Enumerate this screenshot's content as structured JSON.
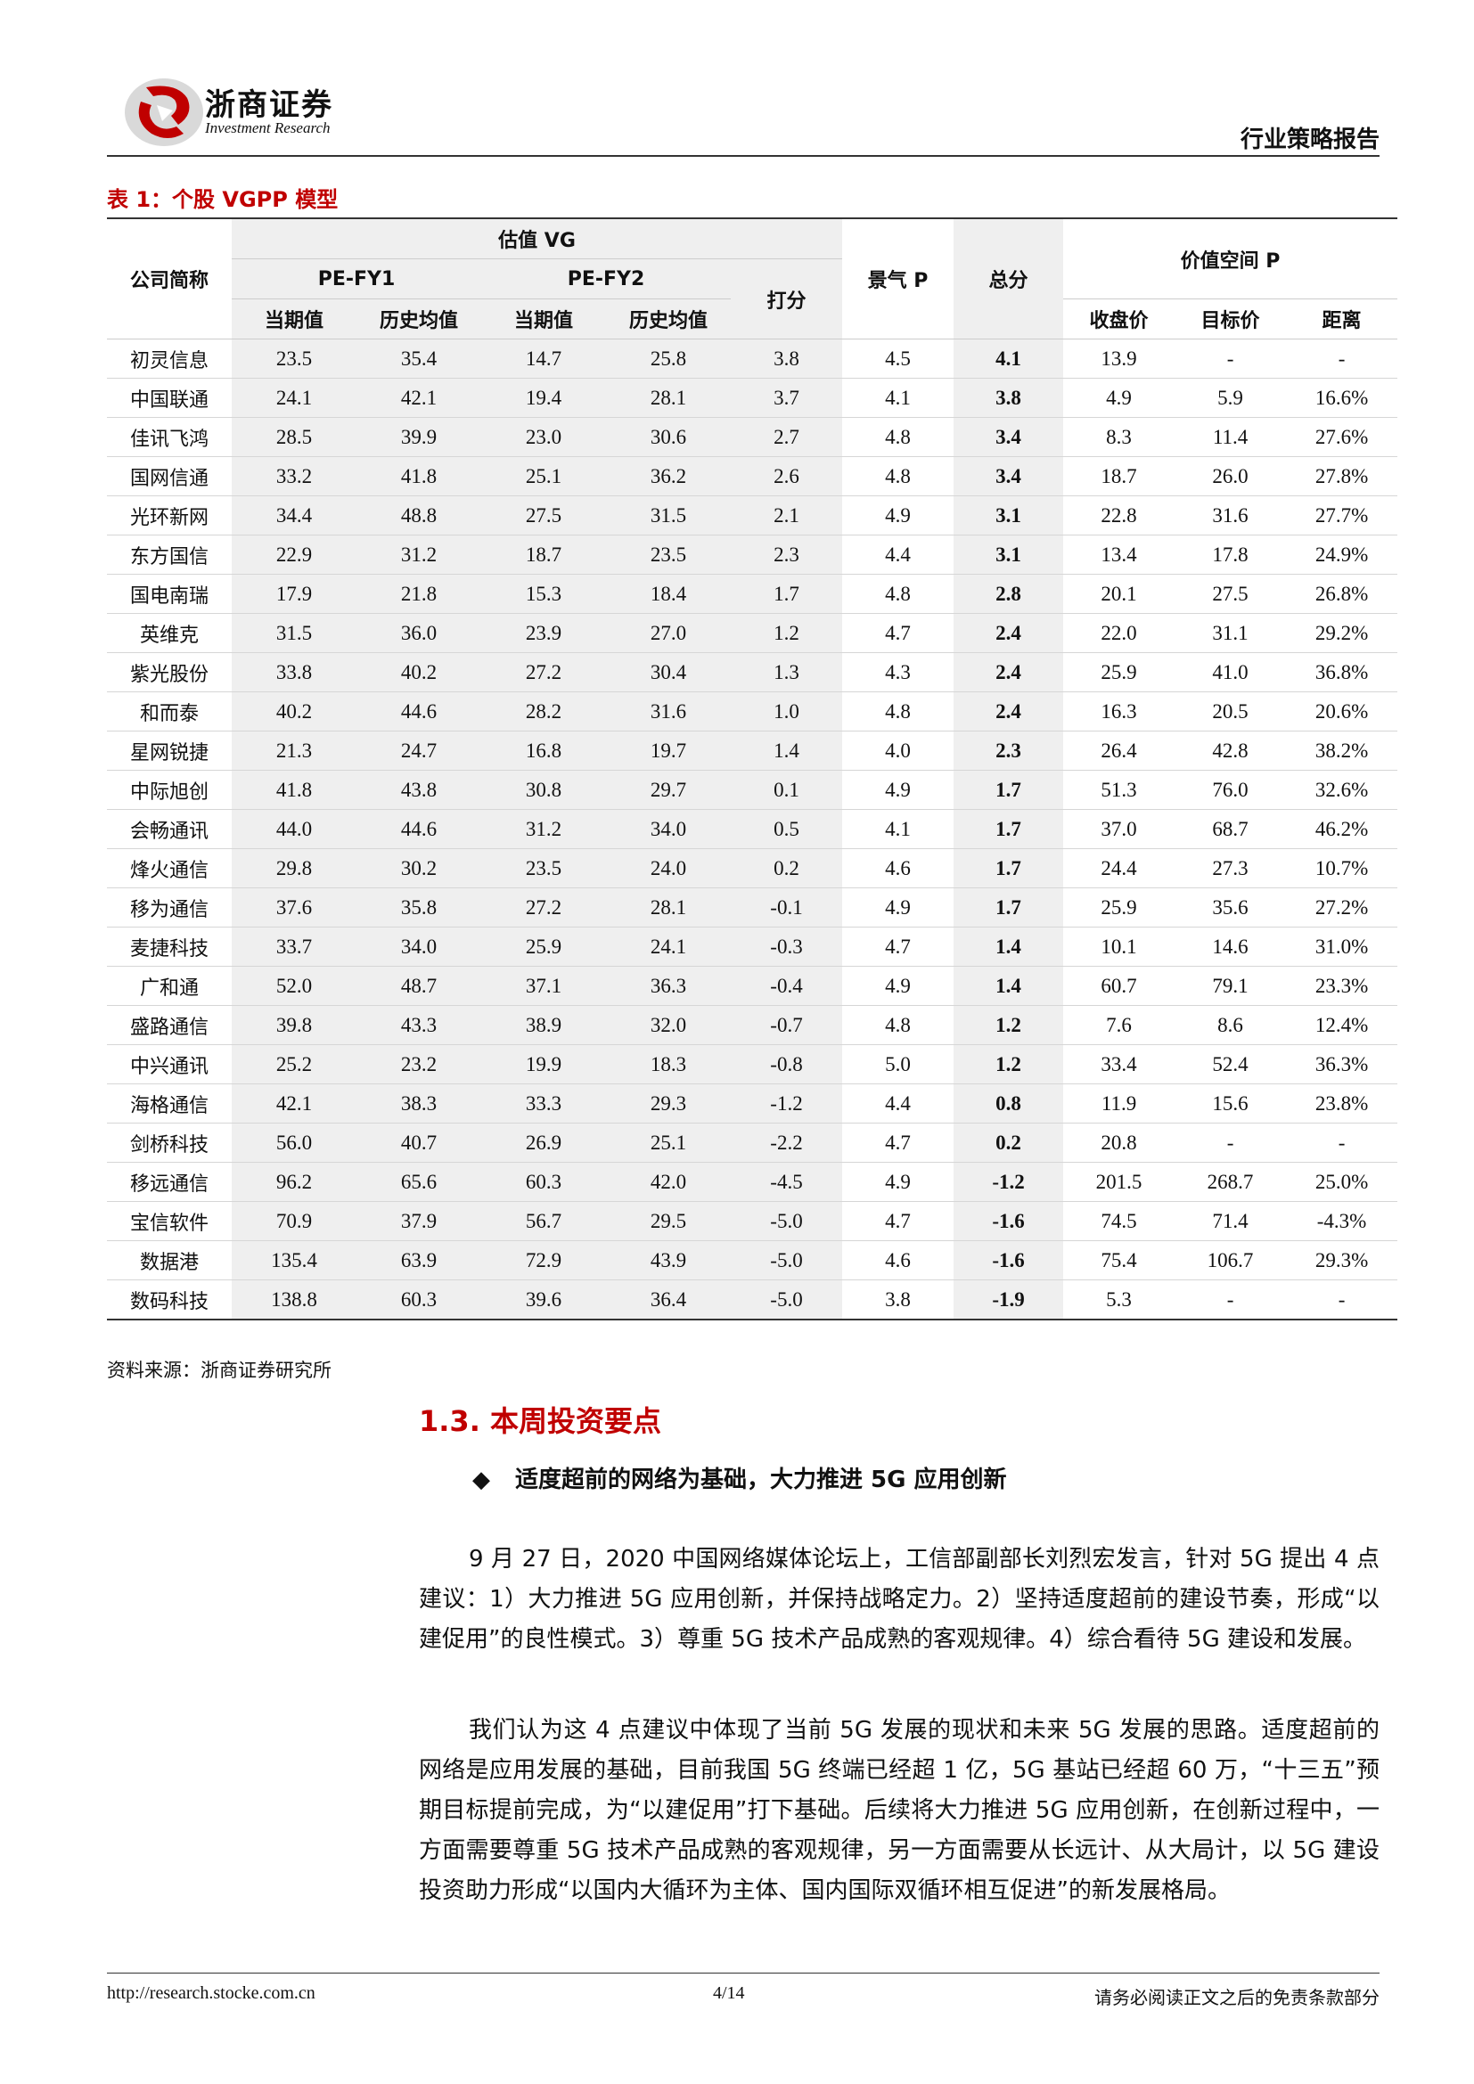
{
  "header": {
    "logo_cn": "浙商证券",
    "logo_en": "Investment Research",
    "report_type": "行业策略报告"
  },
  "table": {
    "title": "表 1：个股 VGPP 模型",
    "headers": {
      "company": "公司简称",
      "valuation": "估值 VG",
      "pe_fy1": "PE-FY1",
      "pe_fy2": "PE-FY2",
      "current": "当期值",
      "hist_avg": "历史均值",
      "score": "打分",
      "sentiment": "景气 P",
      "total": "总分",
      "value_space": "价值空间 P",
      "close": "收盘价",
      "target": "目标价",
      "distance": "距离"
    },
    "rows": [
      [
        "初灵信息",
        "23.5",
        "35.4",
        "14.7",
        "25.8",
        "3.8",
        "4.5",
        "4.1",
        "13.9",
        "-",
        "-"
      ],
      [
        "中国联通",
        "24.1",
        "42.1",
        "19.4",
        "28.1",
        "3.7",
        "4.1",
        "3.8",
        "4.9",
        "5.9",
        "16.6%"
      ],
      [
        "佳讯飞鸿",
        "28.5",
        "39.9",
        "23.0",
        "30.6",
        "2.7",
        "4.8",
        "3.4",
        "8.3",
        "11.4",
        "27.6%"
      ],
      [
        "国网信通",
        "33.2",
        "41.8",
        "25.1",
        "36.2",
        "2.6",
        "4.8",
        "3.4",
        "18.7",
        "26.0",
        "27.8%"
      ],
      [
        "光环新网",
        "34.4",
        "48.8",
        "27.5",
        "31.5",
        "2.1",
        "4.9",
        "3.1",
        "22.8",
        "31.6",
        "27.7%"
      ],
      [
        "东方国信",
        "22.9",
        "31.2",
        "18.7",
        "23.5",
        "2.3",
        "4.4",
        "3.1",
        "13.4",
        "17.8",
        "24.9%"
      ],
      [
        "国电南瑞",
        "17.9",
        "21.8",
        "15.3",
        "18.4",
        "1.7",
        "4.8",
        "2.8",
        "20.1",
        "27.5",
        "26.8%"
      ],
      [
        "英维克",
        "31.5",
        "36.0",
        "23.9",
        "27.0",
        "1.2",
        "4.7",
        "2.4",
        "22.0",
        "31.1",
        "29.2%"
      ],
      [
        "紫光股份",
        "33.8",
        "40.2",
        "27.2",
        "30.4",
        "1.3",
        "4.3",
        "2.4",
        "25.9",
        "41.0",
        "36.8%"
      ],
      [
        "和而泰",
        "40.2",
        "44.6",
        "28.2",
        "31.6",
        "1.0",
        "4.8",
        "2.4",
        "16.3",
        "20.5",
        "20.6%"
      ],
      [
        "星网锐捷",
        "21.3",
        "24.7",
        "16.8",
        "19.7",
        "1.4",
        "4.0",
        "2.3",
        "26.4",
        "42.8",
        "38.2%"
      ],
      [
        "中际旭创",
        "41.8",
        "43.8",
        "30.8",
        "29.7",
        "0.1",
        "4.9",
        "1.7",
        "51.3",
        "76.0",
        "32.6%"
      ],
      [
        "会畅通讯",
        "44.0",
        "44.6",
        "31.2",
        "34.0",
        "0.5",
        "4.1",
        "1.7",
        "37.0",
        "68.7",
        "46.2%"
      ],
      [
        "烽火通信",
        "29.8",
        "30.2",
        "23.5",
        "24.0",
        "0.2",
        "4.6",
        "1.7",
        "24.4",
        "27.3",
        "10.7%"
      ],
      [
        "移为通信",
        "37.6",
        "35.8",
        "27.2",
        "28.1",
        "-0.1",
        "4.9",
        "1.7",
        "25.9",
        "35.6",
        "27.2%"
      ],
      [
        "麦捷科技",
        "33.7",
        "34.0",
        "25.9",
        "24.1",
        "-0.3",
        "4.7",
        "1.4",
        "10.1",
        "14.6",
        "31.0%"
      ],
      [
        "广和通",
        "52.0",
        "48.7",
        "37.1",
        "36.3",
        "-0.4",
        "4.9",
        "1.4",
        "60.7",
        "79.1",
        "23.3%"
      ],
      [
        "盛路通信",
        "39.8",
        "43.3",
        "38.9",
        "32.0",
        "-0.7",
        "4.8",
        "1.2",
        "7.6",
        "8.6",
        "12.4%"
      ],
      [
        "中兴通讯",
        "25.2",
        "23.2",
        "19.9",
        "18.3",
        "-0.8",
        "5.0",
        "1.2",
        "33.4",
        "52.4",
        "36.3%"
      ],
      [
        "海格通信",
        "42.1",
        "38.3",
        "33.3",
        "29.3",
        "-1.2",
        "4.4",
        "0.8",
        "11.9",
        "15.6",
        "23.8%"
      ],
      [
        "剑桥科技",
        "56.0",
        "40.7",
        "26.9",
        "25.1",
        "-2.2",
        "4.7",
        "0.2",
        "20.8",
        "-",
        "-"
      ],
      [
        "移远通信",
        "96.2",
        "65.6",
        "60.3",
        "42.0",
        "-4.5",
        "4.9",
        "-1.2",
        "201.5",
        "268.7",
        "25.0%"
      ],
      [
        "宝信软件",
        "70.9",
        "37.9",
        "56.7",
        "29.5",
        "-5.0",
        "4.7",
        "-1.6",
        "74.5",
        "71.4",
        "-4.3%"
      ],
      [
        "数据港",
        "135.4",
        "63.9",
        "72.9",
        "43.9",
        "-5.0",
        "4.6",
        "-1.6",
        "75.4",
        "106.7",
        "29.3%"
      ],
      [
        "数码科技",
        "138.8",
        "60.3",
        "39.6",
        "36.4",
        "-5.0",
        "3.8",
        "-1.9",
        "5.3",
        "-",
        "-"
      ]
    ],
    "source": "资料来源：浙商证券研究所"
  },
  "section": {
    "title": "1.3. 本周投资要点",
    "bullet": "适度超前的网络为基础，大力推进 5G 应用创新",
    "paragraphs": [
      "9 月 27 日，2020 中国网络媒体论坛上，工信部副部长刘烈宏发言，针对 5G 提出 4 点建议：1）大力推进 5G 应用创新，并保持战略定力。2）坚持适度超前的建设节奏，形成“以建促用”的良性模式。3）尊重 5G 技术产品成熟的客观规律。4）综合看待 5G 建设和发展。",
      "我们认为这 4 点建议中体现了当前 5G 发展的现状和未来 5G 发展的思路。适度超前的网络是应用发展的基础，目前我国 5G 终端已经超 1 亿，5G 基站已经超 60 万，“十三五”预期目标提前完成，为“以建促用”打下基础。后续将大力推进 5G 应用创新，在创新过程中，一方面需要尊重 5G 技术产品成熟的客观规律，另一方面需要从长远计、从大局计，以 5G 建设投资助力形成“以国内大循环为主体、国内国际双循环相互促进”的新发展格局。"
    ]
  },
  "footer": {
    "url": "http://research.stocke.com.cn",
    "page": "4/14",
    "note": "请务必阅读正文之后的免责条款部分"
  },
  "colors": {
    "accent": "#c00000",
    "shade": "#efefef"
  }
}
